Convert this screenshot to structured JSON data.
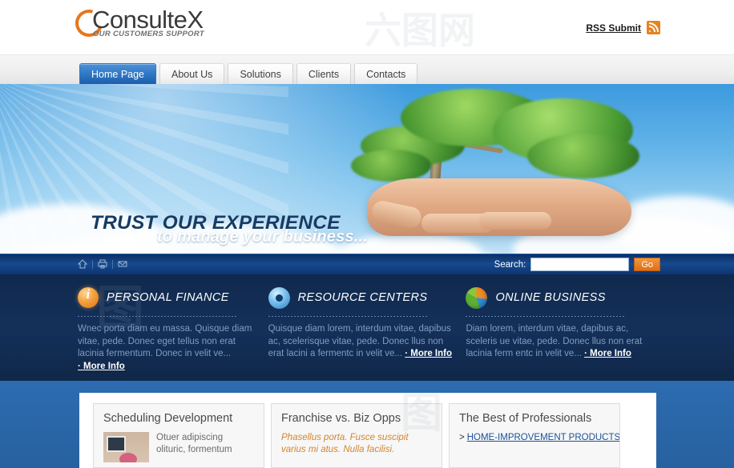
{
  "header": {
    "logo_text": "ConsulteX",
    "logo_tagline": "OUR CUSTOMERS SUPPORT",
    "rss_label": "RSS Submit"
  },
  "nav": {
    "tabs": [
      {
        "label": "Home Page",
        "active": true
      },
      {
        "label": "About Us",
        "active": false
      },
      {
        "label": "Solutions",
        "active": false
      },
      {
        "label": "Clients",
        "active": false
      },
      {
        "label": "Contacts",
        "active": false
      }
    ]
  },
  "hero": {
    "title": "TRUST OUR EXPERIENCE",
    "subtitle": "to manage your business..."
  },
  "utility": {
    "icons": [
      "home-icon",
      "print-icon",
      "mail-icon"
    ],
    "search_label": "Search:",
    "search_value": "",
    "search_placeholder": "",
    "go_label": "Go"
  },
  "features": [
    {
      "icon": "info-badge-icon",
      "title": "PERSONAL FINANCE",
      "body": "Wnec porta diam eu massa. Quisque diam vitae, pede. Donec eget tellus non erat lacinia fermentum. Donec in velit ve...",
      "more_label": "· More Info"
    },
    {
      "icon": "disc-icon",
      "title": "RESOURCE CENTERS",
      "body": "Quisque diam lorem, interdum vitae, dapibus ac, scelerisque vitae, pede. Donec llus non erat lacini a fermentc in velit ve...",
      "more_label": "· More Info"
    },
    {
      "icon": "pie-chart-icon",
      "title": "ONLINE BUSINESS",
      "body": "Diam lorem, interdum vitae, dapibus ac, sceleris ue vitae, pede. Donec llus non erat lacinia ferm entc in velit ve...",
      "more_label": "· More Info"
    }
  ],
  "boxes": [
    {
      "title": "Scheduling Development",
      "thumb": "computer-desk-photo",
      "text": "Otuer adipiscing olituric, formentum",
      "style": "plain"
    },
    {
      "title": "Franchise vs. Biz Opps",
      "text": "Phasellus porta. Fusce suscipit varius mi atus. Nulla facilisi.",
      "style": "orange"
    },
    {
      "title": "The Best of Professionals",
      "links": [
        {
          "arrow": ">",
          "label": "HOME-IMPROVEMENT PRODUCTS"
        }
      ],
      "style": "links"
    }
  ],
  "colors": {
    "accent_orange": "#e8821e",
    "nav_active_blue": "#2f77c4",
    "dark_band": "#14305a",
    "page_blue": "#2a6ab0",
    "link_blue": "#1d4f9a"
  }
}
